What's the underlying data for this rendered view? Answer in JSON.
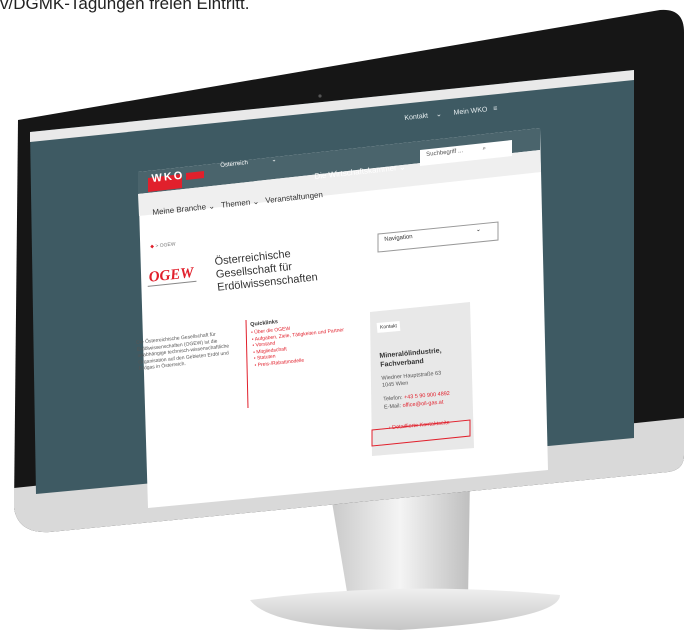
{
  "caption": "v/DGMK-Tagungen freien Eintritt.",
  "browser": {
    "topnav": [
      "Kontakt",
      "Mein WKO"
    ]
  },
  "header": {
    "logo": "WKO",
    "region": "Österreich",
    "search_placeholder": "Suchbegriff ..."
  },
  "menu": {
    "items": [
      "Meine Branche",
      "Themen",
      "Veranstaltungen"
    ],
    "wk_label": "Die Wirtschaftskammer"
  },
  "breadcrumb": "> OGEW",
  "navigation_select": "Navigation",
  "org": {
    "logo_text": "OGEW",
    "name": "Österreichische Gesellschaft für Erdölwissenschaften",
    "description": "Die Österreichische Gesellschaft für Erdölwissenschaften (OGEW) ist die unabhängige technisch-wissenschaftliche Organisation auf den Gebieten Erdöl und Erdgas in Österreich."
  },
  "quicklinks": {
    "title": "Quicklinks",
    "items": [
      "Über die OGEW",
      "Aufgaben, Ziele, Tätigkeiten und Partner",
      "Vorstand",
      "Mitgliedschaft",
      "Statuten",
      "Preis-/Rabattmodelle"
    ]
  },
  "contact": {
    "title": "Kontakt",
    "name": "Mineralölindustrie, Fachverband",
    "address": [
      "Wiedner Hauptstraße 63",
      "1045 Wien"
    ],
    "phone_label": "Telefon:",
    "phone": "+43 5 90 900 4892",
    "email_label": "E-Mail:",
    "email": "office@oil-gas.at",
    "more": "Detaillierte Kontaktseite"
  }
}
